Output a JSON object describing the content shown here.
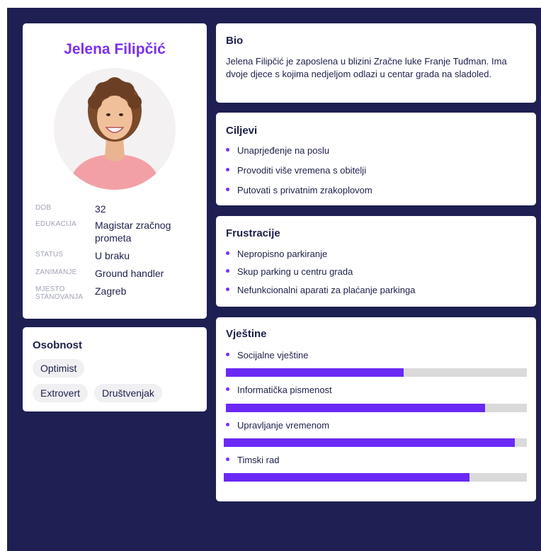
{
  "profile": {
    "name": "Jelena Filipčić",
    "photo_icon": "person-photo",
    "info": [
      {
        "label": "DOB",
        "value": "32"
      },
      {
        "label": "EDUKACIJA",
        "value": "Magistar zračnog prometa"
      },
      {
        "label": "STATUS",
        "value": "U braku"
      },
      {
        "label": "ZANIMANJE",
        "value": "Ground handler"
      },
      {
        "label": "MJESTO STANOVANJA",
        "value": "Zagreb"
      }
    ]
  },
  "personality": {
    "title": "Osobnost",
    "tags": [
      "Optimist",
      "Extrovert",
      "Društvenjak"
    ]
  },
  "bio": {
    "title": "Bio",
    "text": "Jelena Filipčić je zaposlena u blizini Zračne luke Franje Tuđman. Ima dvoje djece s kojima nedjeljom odlazi u centar grada na sladoled."
  },
  "goals": {
    "title": "Ciljevi",
    "items": [
      "Unaprjeđenje na poslu",
      "Provoditi više vremena s obitelji",
      "Putovati s privatnim zrakoplovom"
    ]
  },
  "frustrations": {
    "title": "Frustracije",
    "items": [
      "Nepropisno parkiranje",
      "Skup parking u centru grada",
      "Nefunkcionalni aparati za plaćanje parkinga"
    ]
  },
  "skills": {
    "title": "Vještine",
    "items": [
      {
        "name": "Socijalne vještine",
        "level": 0.59
      },
      {
        "name": "Informatička pismenost",
        "level": 0.86
      },
      {
        "name": "Upravljanje vremenom",
        "level": 0.96
      },
      {
        "name": "Timski rad",
        "level": 0.81
      }
    ]
  },
  "colors": {
    "background": "#1e1f52",
    "accent": "#7b2ff2",
    "bar_fill": "#6a29f5",
    "bar_track": "#dadada"
  }
}
